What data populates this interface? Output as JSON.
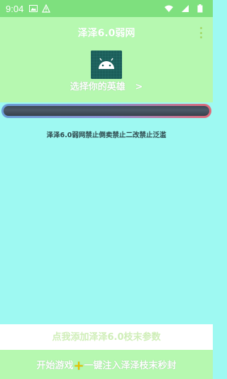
{
  "status_bar": {
    "time": "9:04",
    "icons": [
      "image-icon",
      "warning-icon",
      "wifi-icon",
      "signal-icon",
      "battery-icon"
    ]
  },
  "header": {
    "title": "泽泽6.0弱网",
    "menu_icon": "overflow-menu-icon"
  },
  "hero": {
    "icon": "android-icon",
    "label": "选择你的英雄",
    "arrow": ">"
  },
  "progress": {
    "value": 0
  },
  "notice": "泽泽6.0弱网禁止倒卖禁止二改禁止泛滥",
  "actions": {
    "add_params": "点我添加泽泽6.0枝末参数",
    "start_game_before": "开始游戏",
    "start_game_plus": "+",
    "start_game_after": "一键注入泽泽枝末秒封"
  },
  "colors": {
    "background": "#9ef9f2",
    "top_band": "#b6f8b0",
    "status_bar": "#7ee07e",
    "icon_bg": "#1b5e5a"
  }
}
